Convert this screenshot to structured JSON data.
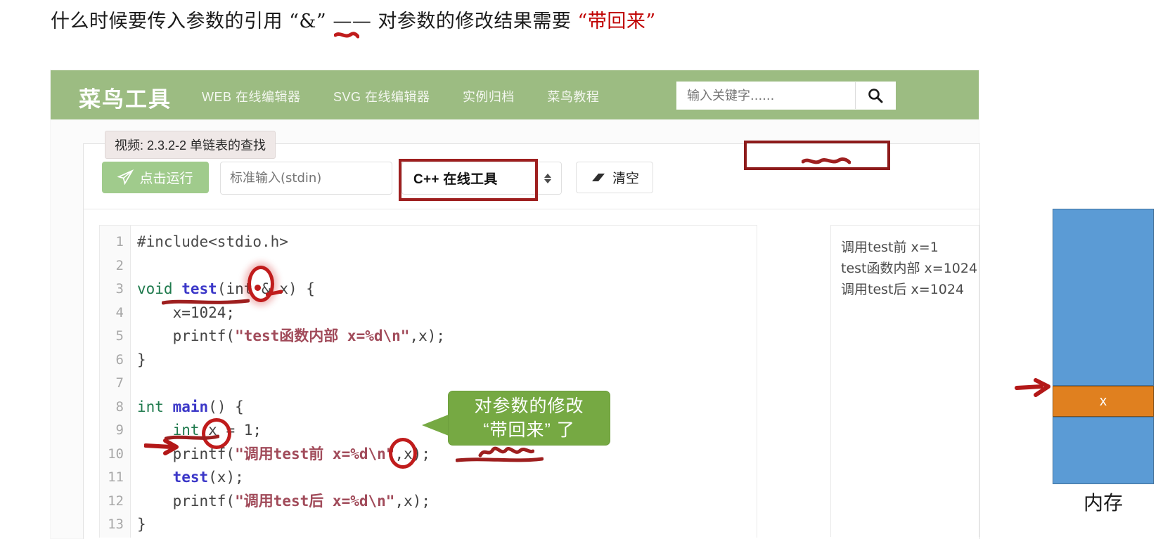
{
  "slide": {
    "title_part1": "什么时候要传入参数的引用",
    "title_amp": "“&”",
    "title_part2": "—— 对参数的修改结果需要",
    "title_highlight": "“带回来”"
  },
  "navbar": {
    "brand": "菜鸟工具",
    "links": [
      "WEB 在线编辑器",
      "SVG 在线编辑器",
      "实例归档",
      "菜鸟教程"
    ],
    "search_placeholder": "输入关键字......",
    "search_value": "",
    "search_icon": "search-icon",
    "bg_color": "#9cbc82"
  },
  "toolbar": {
    "run_label": "点击运行",
    "run_icon": "paper-plane-icon",
    "stdin_placeholder": "标准输入(stdin)",
    "stdin_value": "",
    "language_selected": "C++ 在线工具",
    "clear_label": "清空",
    "clear_icon": "eraser-icon",
    "run_bg": "#a0cb8c"
  },
  "tooltip": {
    "text": "视频: 2.3.2-2 单链表的查找"
  },
  "editor": {
    "line_numbers": [
      "1",
      "2",
      "3",
      "4",
      "5",
      "6",
      "7",
      "8",
      "9",
      "10",
      "11",
      "12",
      "13"
    ],
    "lines": [
      "#include<stdio.h>",
      "",
      "void test(int & x) {",
      "    x=1024;",
      "    printf(\"test函数内部 x=%d\\n\",x);",
      "}",
      "",
      "int main() {",
      "    int x = 1;",
      "    printf(\"调用test前 x=%d\\n\",x);",
      "    test(x);",
      "    printf(\"调用test后 x=%d\\n\",x);",
      "}"
    ]
  },
  "output": {
    "lines": [
      "调用test前 x=1",
      "test函数内部 x=1024",
      "调用test后 x=1024"
    ]
  },
  "callout": {
    "line1": "对参数的修改",
    "line2": "“带回来” 了",
    "bg_color": "#76a943"
  },
  "memory": {
    "label": "内存",
    "cell_label": "x",
    "blue_color": "#5b9bd5",
    "orange_color": "#e0801f"
  },
  "annotation_color": "#c01c1c"
}
